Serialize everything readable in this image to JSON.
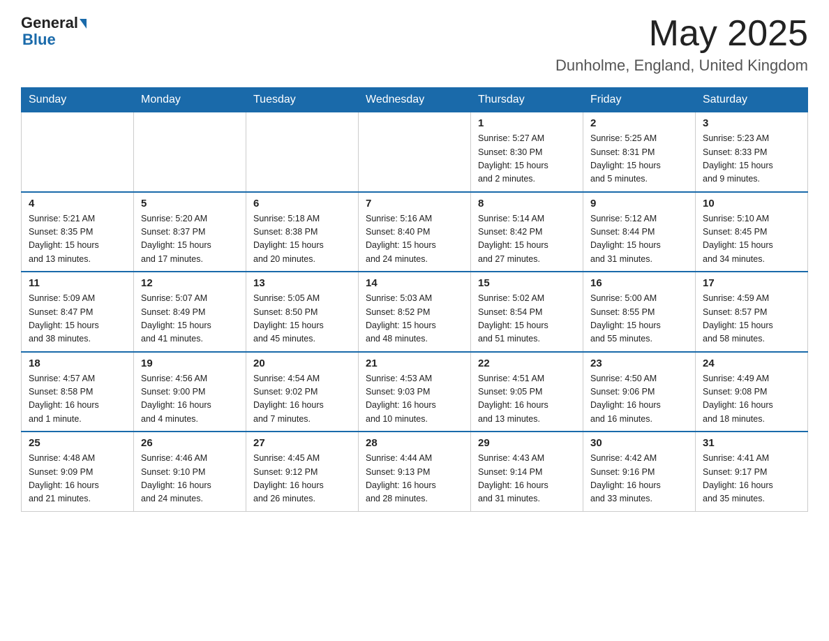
{
  "header": {
    "logo_general": "General",
    "logo_blue": "Blue",
    "month_title": "May 2025",
    "location": "Dunholme, England, United Kingdom"
  },
  "days_of_week": [
    "Sunday",
    "Monday",
    "Tuesday",
    "Wednesday",
    "Thursday",
    "Friday",
    "Saturday"
  ],
  "weeks": [
    [
      {
        "num": "",
        "info": ""
      },
      {
        "num": "",
        "info": ""
      },
      {
        "num": "",
        "info": ""
      },
      {
        "num": "",
        "info": ""
      },
      {
        "num": "1",
        "info": "Sunrise: 5:27 AM\nSunset: 8:30 PM\nDaylight: 15 hours\nand 2 minutes."
      },
      {
        "num": "2",
        "info": "Sunrise: 5:25 AM\nSunset: 8:31 PM\nDaylight: 15 hours\nand 5 minutes."
      },
      {
        "num": "3",
        "info": "Sunrise: 5:23 AM\nSunset: 8:33 PM\nDaylight: 15 hours\nand 9 minutes."
      }
    ],
    [
      {
        "num": "4",
        "info": "Sunrise: 5:21 AM\nSunset: 8:35 PM\nDaylight: 15 hours\nand 13 minutes."
      },
      {
        "num": "5",
        "info": "Sunrise: 5:20 AM\nSunset: 8:37 PM\nDaylight: 15 hours\nand 17 minutes."
      },
      {
        "num": "6",
        "info": "Sunrise: 5:18 AM\nSunset: 8:38 PM\nDaylight: 15 hours\nand 20 minutes."
      },
      {
        "num": "7",
        "info": "Sunrise: 5:16 AM\nSunset: 8:40 PM\nDaylight: 15 hours\nand 24 minutes."
      },
      {
        "num": "8",
        "info": "Sunrise: 5:14 AM\nSunset: 8:42 PM\nDaylight: 15 hours\nand 27 minutes."
      },
      {
        "num": "9",
        "info": "Sunrise: 5:12 AM\nSunset: 8:44 PM\nDaylight: 15 hours\nand 31 minutes."
      },
      {
        "num": "10",
        "info": "Sunrise: 5:10 AM\nSunset: 8:45 PM\nDaylight: 15 hours\nand 34 minutes."
      }
    ],
    [
      {
        "num": "11",
        "info": "Sunrise: 5:09 AM\nSunset: 8:47 PM\nDaylight: 15 hours\nand 38 minutes."
      },
      {
        "num": "12",
        "info": "Sunrise: 5:07 AM\nSunset: 8:49 PM\nDaylight: 15 hours\nand 41 minutes."
      },
      {
        "num": "13",
        "info": "Sunrise: 5:05 AM\nSunset: 8:50 PM\nDaylight: 15 hours\nand 45 minutes."
      },
      {
        "num": "14",
        "info": "Sunrise: 5:03 AM\nSunset: 8:52 PM\nDaylight: 15 hours\nand 48 minutes."
      },
      {
        "num": "15",
        "info": "Sunrise: 5:02 AM\nSunset: 8:54 PM\nDaylight: 15 hours\nand 51 minutes."
      },
      {
        "num": "16",
        "info": "Sunrise: 5:00 AM\nSunset: 8:55 PM\nDaylight: 15 hours\nand 55 minutes."
      },
      {
        "num": "17",
        "info": "Sunrise: 4:59 AM\nSunset: 8:57 PM\nDaylight: 15 hours\nand 58 minutes."
      }
    ],
    [
      {
        "num": "18",
        "info": "Sunrise: 4:57 AM\nSunset: 8:58 PM\nDaylight: 16 hours\nand 1 minute."
      },
      {
        "num": "19",
        "info": "Sunrise: 4:56 AM\nSunset: 9:00 PM\nDaylight: 16 hours\nand 4 minutes."
      },
      {
        "num": "20",
        "info": "Sunrise: 4:54 AM\nSunset: 9:02 PM\nDaylight: 16 hours\nand 7 minutes."
      },
      {
        "num": "21",
        "info": "Sunrise: 4:53 AM\nSunset: 9:03 PM\nDaylight: 16 hours\nand 10 minutes."
      },
      {
        "num": "22",
        "info": "Sunrise: 4:51 AM\nSunset: 9:05 PM\nDaylight: 16 hours\nand 13 minutes."
      },
      {
        "num": "23",
        "info": "Sunrise: 4:50 AM\nSunset: 9:06 PM\nDaylight: 16 hours\nand 16 minutes."
      },
      {
        "num": "24",
        "info": "Sunrise: 4:49 AM\nSunset: 9:08 PM\nDaylight: 16 hours\nand 18 minutes."
      }
    ],
    [
      {
        "num": "25",
        "info": "Sunrise: 4:48 AM\nSunset: 9:09 PM\nDaylight: 16 hours\nand 21 minutes."
      },
      {
        "num": "26",
        "info": "Sunrise: 4:46 AM\nSunset: 9:10 PM\nDaylight: 16 hours\nand 24 minutes."
      },
      {
        "num": "27",
        "info": "Sunrise: 4:45 AM\nSunset: 9:12 PM\nDaylight: 16 hours\nand 26 minutes."
      },
      {
        "num": "28",
        "info": "Sunrise: 4:44 AM\nSunset: 9:13 PM\nDaylight: 16 hours\nand 28 minutes."
      },
      {
        "num": "29",
        "info": "Sunrise: 4:43 AM\nSunset: 9:14 PM\nDaylight: 16 hours\nand 31 minutes."
      },
      {
        "num": "30",
        "info": "Sunrise: 4:42 AM\nSunset: 9:16 PM\nDaylight: 16 hours\nand 33 minutes."
      },
      {
        "num": "31",
        "info": "Sunrise: 4:41 AM\nSunset: 9:17 PM\nDaylight: 16 hours\nand 35 minutes."
      }
    ]
  ]
}
